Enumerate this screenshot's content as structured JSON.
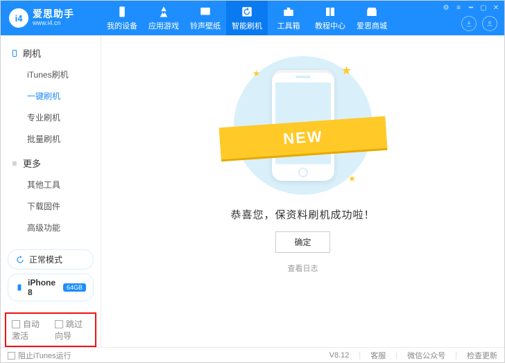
{
  "brand": {
    "title": "爱思助手",
    "subtitle": "www.i4.cn",
    "logo_text": "i4"
  },
  "topnav": [
    {
      "label": "我的设备"
    },
    {
      "label": "应用游戏"
    },
    {
      "label": "铃声壁纸"
    },
    {
      "label": "智能刷机",
      "active": true
    },
    {
      "label": "工具箱"
    },
    {
      "label": "教程中心"
    },
    {
      "label": "爱思商城"
    }
  ],
  "sidebar": {
    "group1": {
      "title": "刷机",
      "items": [
        "iTunes刷机",
        "一键刷机",
        "专业刷机",
        "批量刷机"
      ],
      "activeIndex": 1
    },
    "group2": {
      "title": "更多",
      "items": [
        "其他工具",
        "下载固件",
        "高级功能"
      ]
    }
  },
  "mode_chip": "正常模式",
  "device": {
    "name": "iPhone 8",
    "storage": "64GB"
  },
  "bottom_checks": {
    "auto_activate": "自动激活",
    "skip_guide": "跳过向导"
  },
  "main": {
    "ribbon": "NEW",
    "success_text": "恭喜您，保资料刷机成功啦！",
    "ok_button": "确定",
    "log_link": "查看日志"
  },
  "statusbar": {
    "block_itunes": "阻止iTunes运行",
    "version": "V8.12",
    "support": "客服",
    "wechat": "微信公众号",
    "update": "检查更新"
  }
}
